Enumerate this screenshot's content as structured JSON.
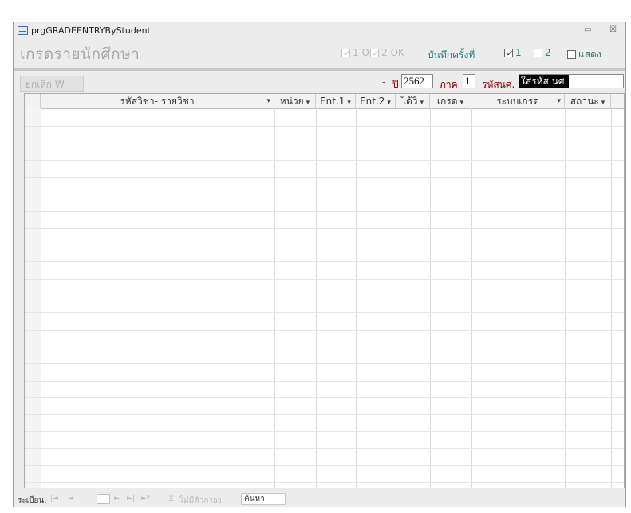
{
  "window": {
    "title": "prgGRADEENTRYByStudent",
    "minimize_glyph": "▭",
    "close_glyph": "☒"
  },
  "header": {
    "form_title": "เกรดรายนักศึกษา",
    "ok1_label": "1 OK",
    "ok2_label": "2 OK",
    "save_label": "บันทึกครั้งที่",
    "opt1_label": "1",
    "opt2_label": "2",
    "show_label": "แสดง",
    "ok1_checked": true,
    "ok2_checked": true,
    "opt1_checked": true,
    "opt2_checked": false,
    "show_checked": false
  },
  "filters": {
    "cancel_button": "ยกเลิก W",
    "dash": "-",
    "year_label": "ปี",
    "year_value": "2562",
    "term_label": "ภาค",
    "term_value": "1",
    "student_label": "รหัสนศ.",
    "student_value": "ใส่รหัส นศ."
  },
  "grid": {
    "columns": [
      {
        "label": "รหัสวิชา- รายวิชา"
      },
      {
        "label": "หน่วย"
      },
      {
        "label": "Ent.1"
      },
      {
        "label": "Ent.2"
      },
      {
        "label": "ได้วิ"
      },
      {
        "label": "เกรด"
      },
      {
        "label": "ระบบเกรด"
      },
      {
        "label": "สถานะ"
      }
    ],
    "dropdown_glyph": "▾"
  },
  "navbar": {
    "record_label": "ระเบียน:",
    "first_glyph": "|◄",
    "prev_glyph": "◄",
    "next_glyph": "►",
    "last_glyph": "►|",
    "new_glyph": "►*",
    "filter_icon": "funnel-x-icon",
    "filter_glyph": "⊻",
    "filter_label": "ไม่มีตัวกรอง",
    "search_label": "ค้นหา"
  },
  "colors": {
    "window_bg": "#ececec",
    "label_teal": "#1f7f80",
    "label_darkred": "#8b0000",
    "title_gray": "#a8a8a8"
  }
}
